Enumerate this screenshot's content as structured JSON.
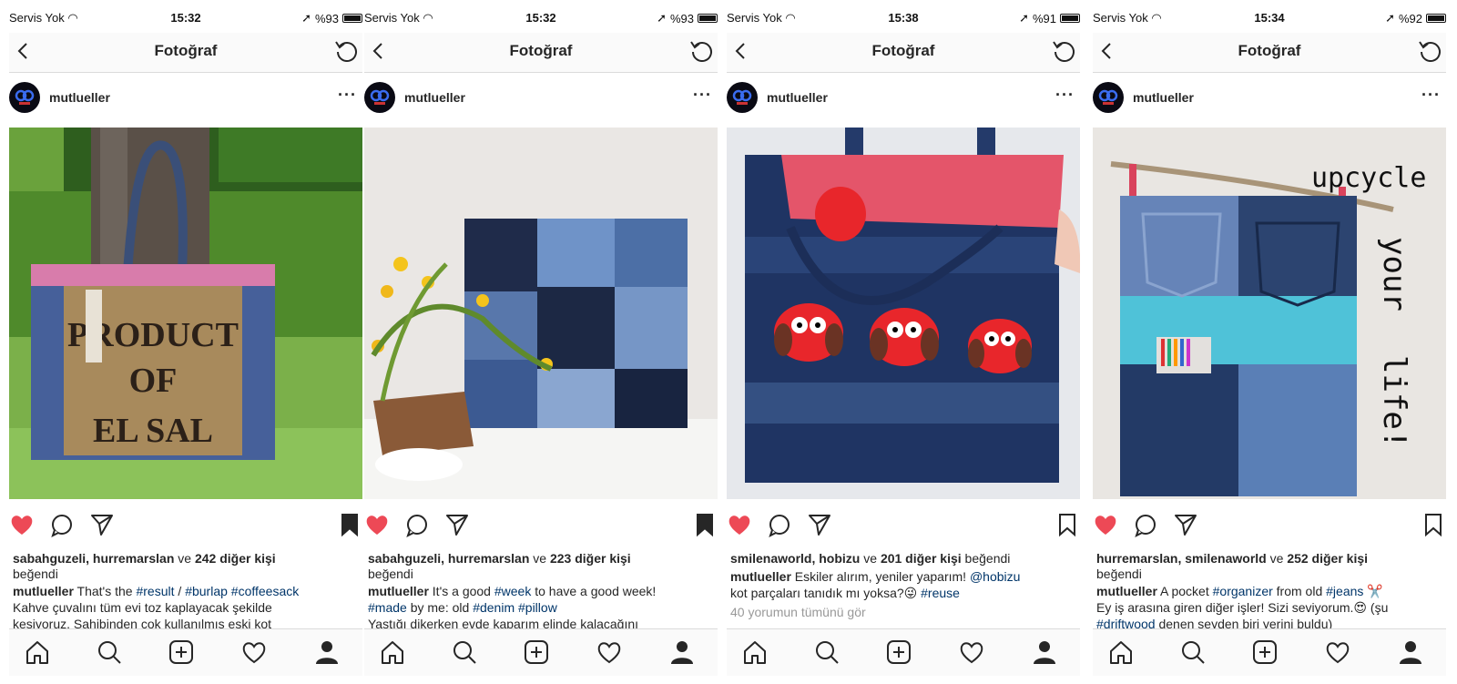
{
  "screens": [
    {
      "status": {
        "carrier": "Servis Yok",
        "time": "15:32",
        "battery": "%93"
      },
      "nav_title": "Fotoğraf",
      "username": "mutlueller",
      "more": "···",
      "bookmark_filled": true,
      "likes": {
        "names": "sabahguzeli, hurremarslan",
        "mid": " ve ",
        "count": "242 diğer kişi",
        "end": " beğendi"
      },
      "caption": {
        "user": "mutlueller",
        "text1": " That's the ",
        "tag1": "#result",
        "text2": " / ",
        "tag2": "#burlap",
        "text3": " ",
        "tag3": "#coffeesack"
      },
      "caption_line2": "Kahve çuvalını tüm evi toz kaplayacak şekilde",
      "caption_line3": "kesiyoruz. Sahibinden çok kullanılmış eski kot"
    },
    {
      "status": {
        "carrier": "Servis Yok",
        "time": "15:32",
        "battery": "%93"
      },
      "nav_title": "Fotoğraf",
      "username": "mutlueller",
      "more": "···",
      "bookmark_filled": true,
      "likes": {
        "names": "sabahguzeli, hurremarslan",
        "mid": " ve ",
        "count": "223 diğer kişi",
        "end": " beğendi"
      },
      "caption": {
        "user": "mutlueller",
        "text1": " It's a good ",
        "tag1": "#week",
        "text2": " to have a good week!",
        "tag2": "#made",
        "text3": " by me: old ",
        "tag3": "#denim",
        "text4": " ",
        "tag4": "#pillow"
      },
      "caption_line3": "Yastığı dikerken evde kaparım elinde kalacağını"
    },
    {
      "status": {
        "carrier": "Servis Yok",
        "time": "15:38",
        "battery": "%91"
      },
      "nav_title": "Fotoğraf",
      "username": "mutlueller",
      "more": "···",
      "bookmark_filled": false,
      "likes": {
        "names": "smilenaworld, hobizu",
        "mid": " ve ",
        "count": "201 diğer kişi",
        "end": " beğendi"
      },
      "caption": {
        "user": "mutlueller",
        "text1": " Eskiler alırım, yeniler yaparım! ",
        "tag1": "@hobizu",
        "text2": "kot parçaları tanıdık mı yoksa?😜 ",
        "tag2": "#reuse"
      },
      "comments": "40 yorumun tümünü gör"
    },
    {
      "status": {
        "carrier": "Servis Yok",
        "time": "15:34",
        "battery": "%92"
      },
      "nav_title": "Fotoğraf",
      "username": "mutlueller",
      "more": "···",
      "bookmark_filled": false,
      "likes": {
        "names": "hurremarslan, smilenaworld",
        "mid": " ve ",
        "count": "252 diğer kişi",
        "end": " beğendi"
      },
      "caption": {
        "user": "mutlueller",
        "text1": " A pocket ",
        "tag1": "#organizer",
        "text2": " from old ",
        "tag2": "#jeans",
        "text3": " ✂️",
        "line2": "Ey iş arasına giren diğer işler! Sizi seviyorum.😍 (şu",
        "tag3": "#driftwood",
        "line3": " denen seyden biri yerini buldu)"
      },
      "photo_text": [
        "upcycle",
        "your",
        "life!"
      ]
    }
  ],
  "colors": {
    "heart": "#ed4956",
    "link": "#003569",
    "denim": "#2f4a7a"
  }
}
